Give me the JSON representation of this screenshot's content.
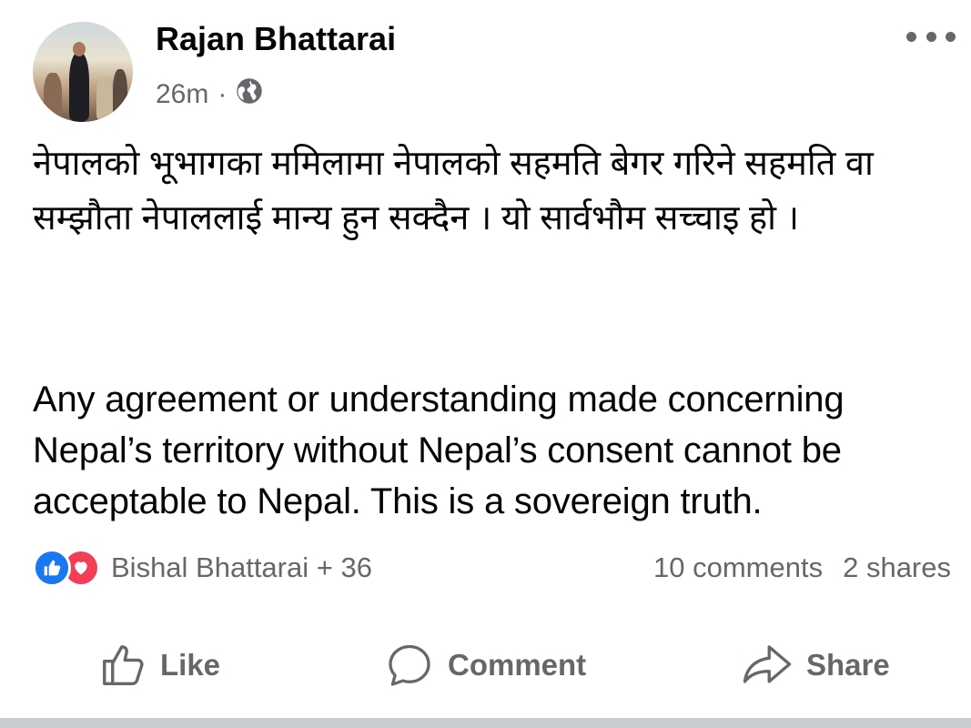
{
  "post": {
    "author": "Rajan Bhattarai",
    "time": "26m",
    "separator": "·",
    "audience_icon": "globe-icon",
    "more_icon": "more-options-icon",
    "text_nepali": "नेपालको भूभागका ममिलामा नेपालको सहमति बेगर गरिने सहमति वा सम्झौता नेपाललाई मान्य हुन सक्दैन । यो सार्वभौम सच्चाइ हो ।",
    "text_english": "Any agreement or understanding made concerning Nepal’s territory without Nepal’s consent cannot be acceptable to Nepal. This is a sovereign truth."
  },
  "reactions": {
    "icons": [
      "like-reaction-icon",
      "love-reaction-icon"
    ],
    "names": "Bishal Bhattarai + 36",
    "comments": "10 comments",
    "shares": "2 shares"
  },
  "actions": {
    "like": "Like",
    "comment": "Comment",
    "share": "Share"
  },
  "colors": {
    "like_blue": "#1877f2",
    "love_red": "#f33e58",
    "secondary_text": "#65676b",
    "primary_text": "#050505"
  }
}
